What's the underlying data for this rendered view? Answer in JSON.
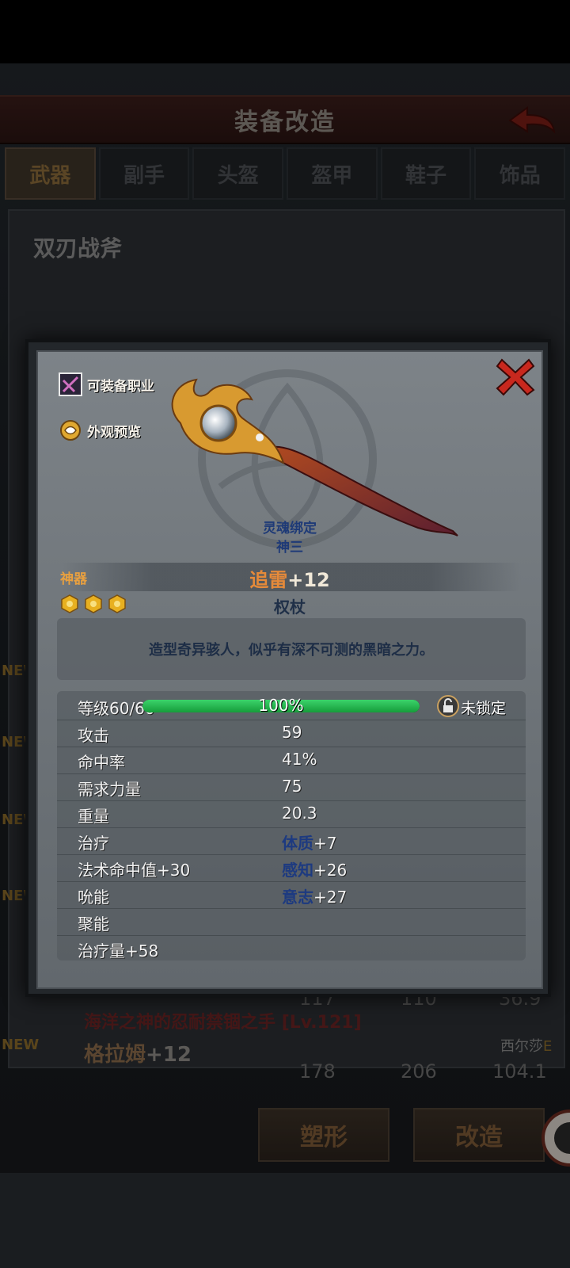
{
  "header": {
    "title": "装备改造"
  },
  "tabs": [
    {
      "label": "武器"
    },
    {
      "label": "副手"
    },
    {
      "label": "头盔"
    },
    {
      "label": "盔甲"
    },
    {
      "label": "鞋子"
    },
    {
      "label": "饰品"
    }
  ],
  "background_list": {
    "current_item_name": "双刃战斧",
    "new_badge": "NEW",
    "row_a": {
      "stats": [
        "117",
        "110",
        "36.9"
      ],
      "name": "海洋之神的忍耐禁锢之手",
      "level": "[Lv.121]"
    },
    "row_b": {
      "title": "格拉姆",
      "plus": "+12",
      "owner": "西尔莎",
      "grade": "E",
      "stats": [
        "178",
        "206",
        "104.1"
      ]
    }
  },
  "buttons": {
    "reshape": "塑形",
    "modify": "改造"
  },
  "modal": {
    "equip_class_link": "可装备职业",
    "appearance_link": "外观预览",
    "soul_bind": "灵魂绑定",
    "owner": "神三",
    "rarity": "神器",
    "item_name": "追雷",
    "item_plus": "+12",
    "item_type": "权杖",
    "stars": 3,
    "description": "造型奇异骇人，似乎有深不可测的黑暗之力。",
    "level_label": "等级60/60",
    "level_percent": "100%",
    "level_fill": 1.0,
    "lock_status": "未锁定",
    "stats": [
      {
        "label": "攻击",
        "value": "59"
      },
      {
        "label": "命中率",
        "value": "41%"
      },
      {
        "label": "需求力量",
        "value": "75"
      },
      {
        "label": "重量",
        "value": "20.3"
      }
    ],
    "bonuses": [
      {
        "left": "治疗",
        "right_name": "体质",
        "right_value": "+7"
      },
      {
        "left": "法术命中值+30",
        "right_name": "感知",
        "right_value": "+26"
      },
      {
        "left": "吮能",
        "right_name": "意志",
        "right_value": "+27"
      },
      {
        "left": "聚能",
        "right_name": "",
        "right_value": ""
      },
      {
        "left": "治疗量+58",
        "right_name": "",
        "right_value": ""
      }
    ]
  },
  "colors": {
    "rarity": "#e8a040",
    "item_name": "#e58a3a",
    "level_bar": "#2ec45a",
    "blue_stat": "#1d3a80"
  }
}
